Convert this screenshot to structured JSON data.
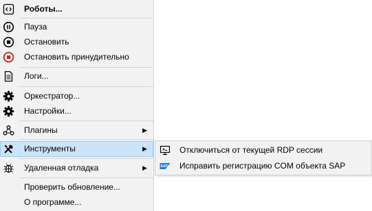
{
  "menu": {
    "items": [
      {
        "label": "Роботы...",
        "icon": "code-box-icon"
      },
      {
        "label": "Пауза",
        "icon": "pause-circle-icon"
      },
      {
        "label": "Остановить",
        "icon": "stop-circle-icon"
      },
      {
        "label": "Остановить принудительно",
        "icon": "force-stop-icon",
        "icon_color": "#c42b1c"
      },
      {
        "label": "Логи...",
        "icon": "document-icon"
      },
      {
        "label": "Оркестратор...",
        "icon": "gear-icon"
      },
      {
        "label": "Настройки...",
        "icon": "gear-icon"
      },
      {
        "label": "Плагины",
        "icon": "plugin-nodes-icon",
        "submenu_arrow": "▶"
      },
      {
        "label": "Инструменты",
        "icon": "tools-icon",
        "submenu_arrow": "▶",
        "active": true
      },
      {
        "label": "Удаленная отладка",
        "icon": "bug-icon",
        "submenu_arrow": "▶"
      },
      {
        "label": "Проверить обновление...",
        "icon": ""
      },
      {
        "label": "О программе...",
        "icon": ""
      }
    ]
  },
  "submenu": {
    "items": [
      {
        "label": "Отключиться от текущей RDP сессии",
        "icon": "monitor-disconnect-icon"
      },
      {
        "label": "Исправить регистрацию COM объекта SAP",
        "icon": "sap-logo-icon",
        "icon_color": "#1a7bd6"
      }
    ]
  },
  "colors": {
    "menu_background": "#f2f2f2",
    "highlight": "#cce4f7",
    "highlight_border": "#99c9ef"
  }
}
